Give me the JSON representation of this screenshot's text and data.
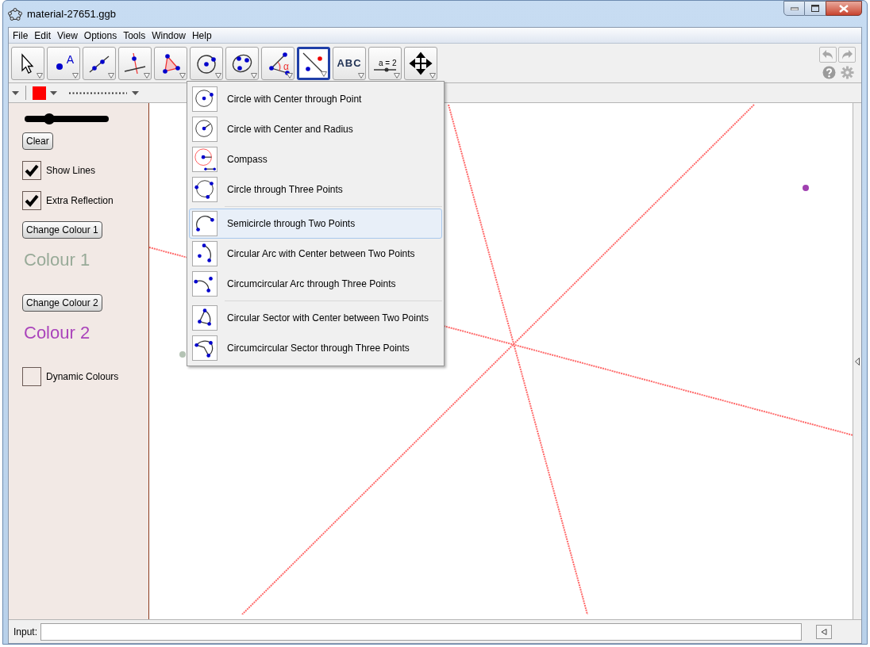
{
  "window": {
    "title": "material-27651.ggb"
  },
  "menu_bar": [
    "File",
    "Edit",
    "View",
    "Options",
    "Tools",
    "Window",
    "Help"
  ],
  "toolbar": {
    "tools": [
      {
        "kind": "pointer",
        "selected": false
      },
      {
        "kind": "point",
        "label": "A",
        "selected": false
      },
      {
        "kind": "line",
        "selected": false
      },
      {
        "kind": "perpendicular",
        "selected": false
      },
      {
        "kind": "polygon",
        "selected": false
      },
      {
        "kind": "circle",
        "selected": false
      },
      {
        "kind": "conic",
        "selected": false
      },
      {
        "kind": "angle",
        "label": "α",
        "selected": false
      },
      {
        "kind": "reflect",
        "selected": true
      },
      {
        "kind": "text",
        "label": "ABC",
        "selected": false
      },
      {
        "kind": "slider",
        "label": "a = 2",
        "selected": false
      },
      {
        "kind": "move",
        "selected": false
      }
    ]
  },
  "style_bar": {
    "color": "#ff0000"
  },
  "tool_menu": {
    "groups": [
      [
        {
          "kind": "circle-center-point",
          "label": "Circle with Center through Point",
          "selected": false
        },
        {
          "kind": "circle-center-radius",
          "label": "Circle with Center and Radius",
          "selected": false
        },
        {
          "kind": "compass",
          "label": "Compass",
          "selected": false
        },
        {
          "kind": "circle-three",
          "label": "Circle through Three Points",
          "selected": false
        }
      ],
      [
        {
          "kind": "semicircle",
          "label": "Semicircle through Two Points",
          "selected": true
        },
        {
          "kind": "arc-center",
          "label": "Circular Arc with Center between Two Points",
          "selected": false
        },
        {
          "kind": "circumarc",
          "label": "Circumcircular Arc through Three Points",
          "selected": false
        }
      ],
      [
        {
          "kind": "sector-center",
          "label": "Circular Sector with Center between Two Points",
          "selected": false
        },
        {
          "kind": "circumsector",
          "label": "Circumcircular Sector through Three Points",
          "selected": false
        }
      ]
    ]
  },
  "panel": {
    "slider": {
      "level": 0.29
    },
    "items": [
      {
        "kind": "button",
        "label": "Clear"
      },
      {
        "kind": "checkbox",
        "label": "Show Lines",
        "checked": true
      },
      {
        "kind": "checkbox",
        "label": "Extra Reflection",
        "checked": true
      },
      {
        "kind": "button",
        "label": "Change Colour 1"
      },
      {
        "kind": "caption",
        "label": "Colour 1",
        "color": "#98aa98"
      },
      {
        "kind": "button",
        "label": "Change Colour 2"
      },
      {
        "kind": "caption",
        "label": "Colour 2",
        "color": "#aa44bb"
      },
      {
        "kind": "checkbox",
        "label": "Dynamic Colours",
        "checked": false
      }
    ]
  },
  "input_bar": {
    "label": "Input:"
  }
}
